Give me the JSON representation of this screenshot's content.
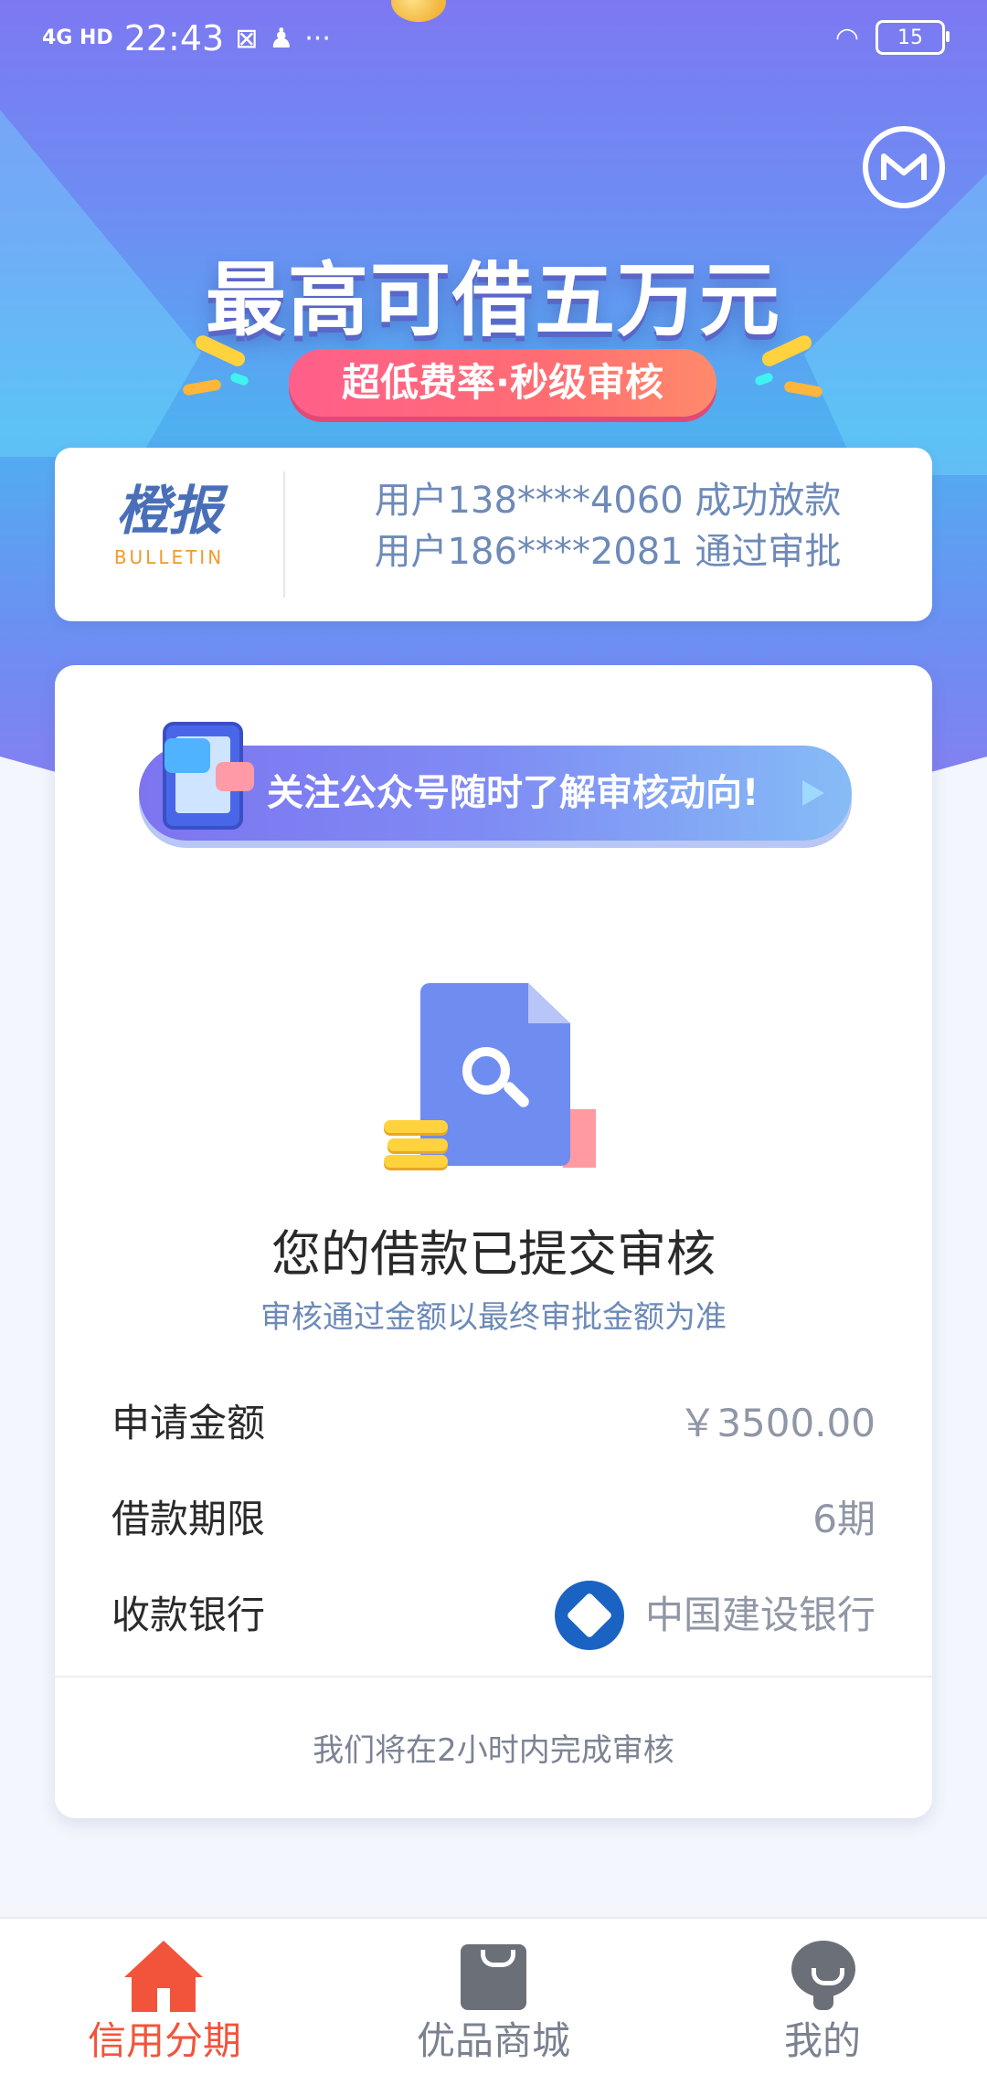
{
  "status_bar": {
    "network": "4G HD",
    "time": "22:43",
    "icons": [
      "sim-card-icon",
      "qq-icon",
      "more-dots-icon"
    ],
    "battery": "15"
  },
  "hero": {
    "title": "最高可借五万元",
    "badge": "超低费率·秒级审核"
  },
  "bulletin": {
    "logo_cn": "橙报",
    "logo_en": "BULLETIN",
    "lines": [
      "用户138****4060 成功放款",
      "用户186****2081 通过审批"
    ]
  },
  "follow_banner": {
    "text": "关注公众号随时了解审核动向!"
  },
  "status": {
    "title": "您的借款已提交审核",
    "subtitle": "审核通过金额以最终审批金额为准"
  },
  "details": [
    {
      "label": "申请金额",
      "value": "￥3500.00"
    },
    {
      "label": "借款期限",
      "value": "6期"
    },
    {
      "label": "收款银行",
      "value": "中国建设银行"
    }
  ],
  "footer_note": "我们将在2小时内完成审核",
  "tabs": [
    {
      "label": "信用分期",
      "icon": "home-icon",
      "active": true
    },
    {
      "label": "优品商城",
      "icon": "shopping-bag-icon",
      "active": false
    },
    {
      "label": "我的",
      "icon": "profile-icon",
      "active": false
    }
  ],
  "colors": {
    "accent": "#f2543b",
    "link_blue": "#6d8ab8",
    "hero_purple": "#7d78f2",
    "hero_cyan": "#4fb0f0"
  }
}
